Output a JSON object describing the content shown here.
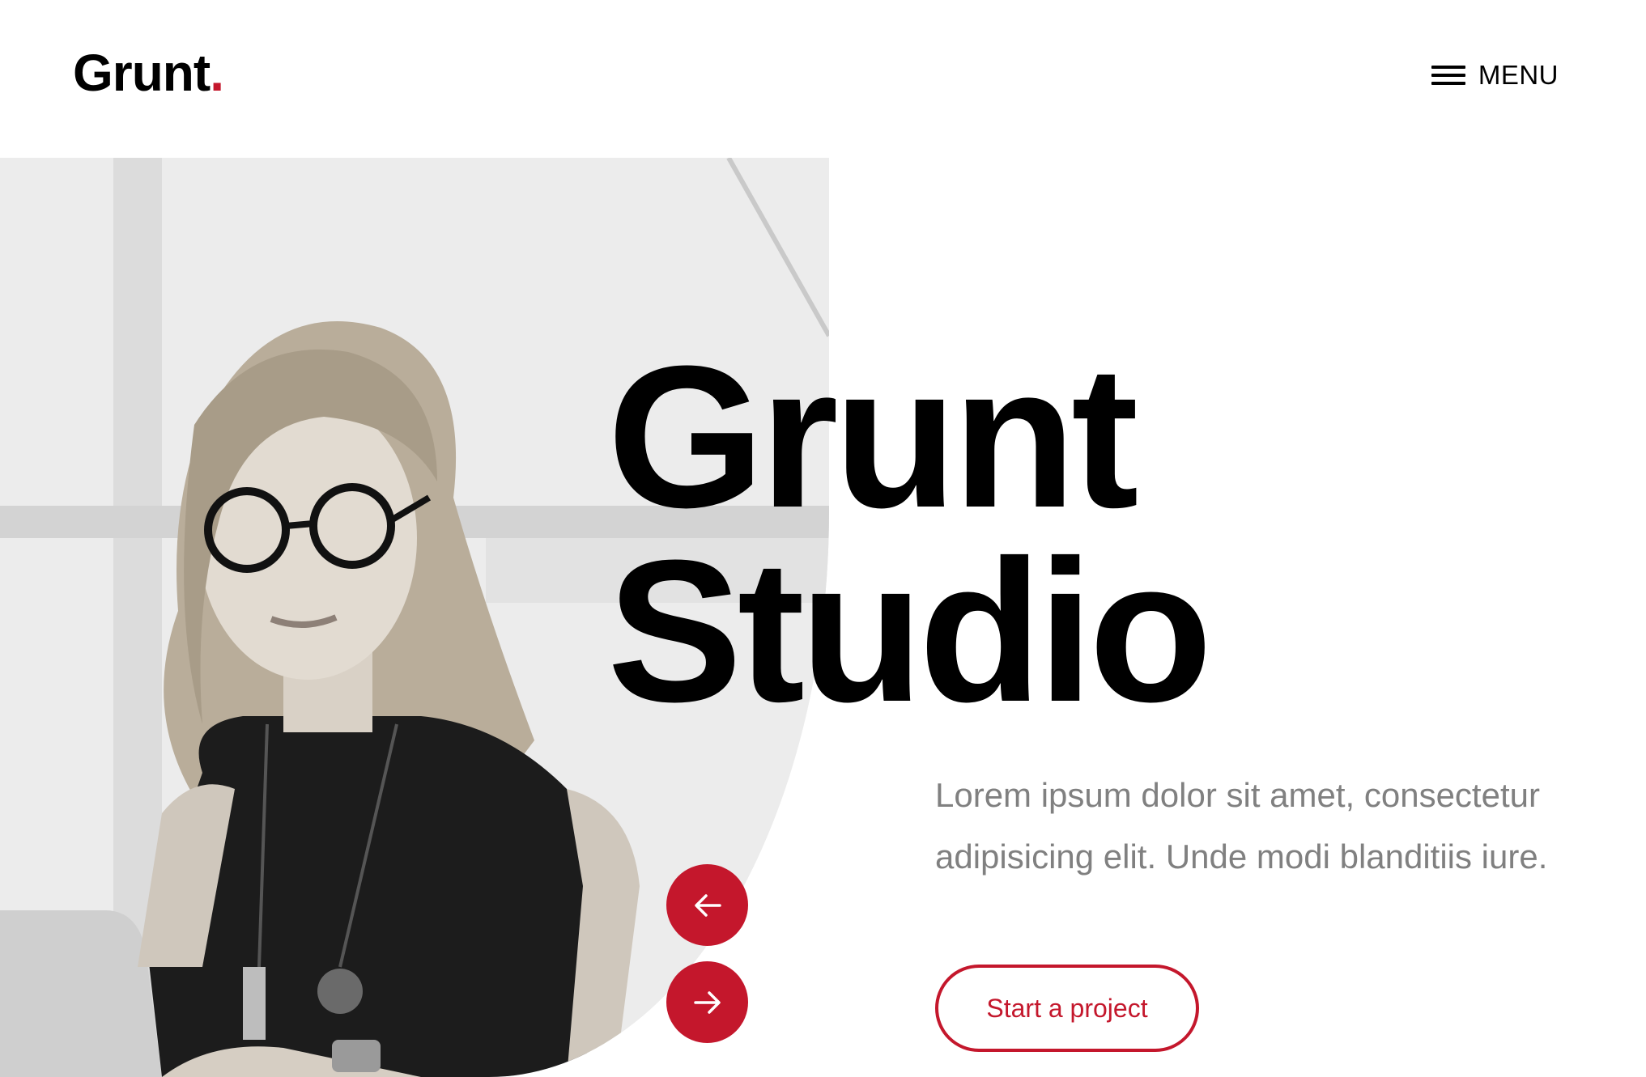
{
  "header": {
    "logo_text": "Grunt",
    "logo_dot": ".",
    "menu_label": "MENU"
  },
  "hero": {
    "title_line_1": "Grunt",
    "title_line_2": "Studio",
    "lead": "Lorem ipsum dolor sit amet, consectetur adipisicing elit. Unde modi blanditiis iure.",
    "cta_label": "Start a project"
  },
  "slider": {
    "prev_icon": "arrow-left-icon",
    "next_icon": "arrow-right-icon"
  },
  "colors": {
    "accent": "#c4172c",
    "text": "#000000",
    "muted": "#808080",
    "background": "#ffffff"
  }
}
